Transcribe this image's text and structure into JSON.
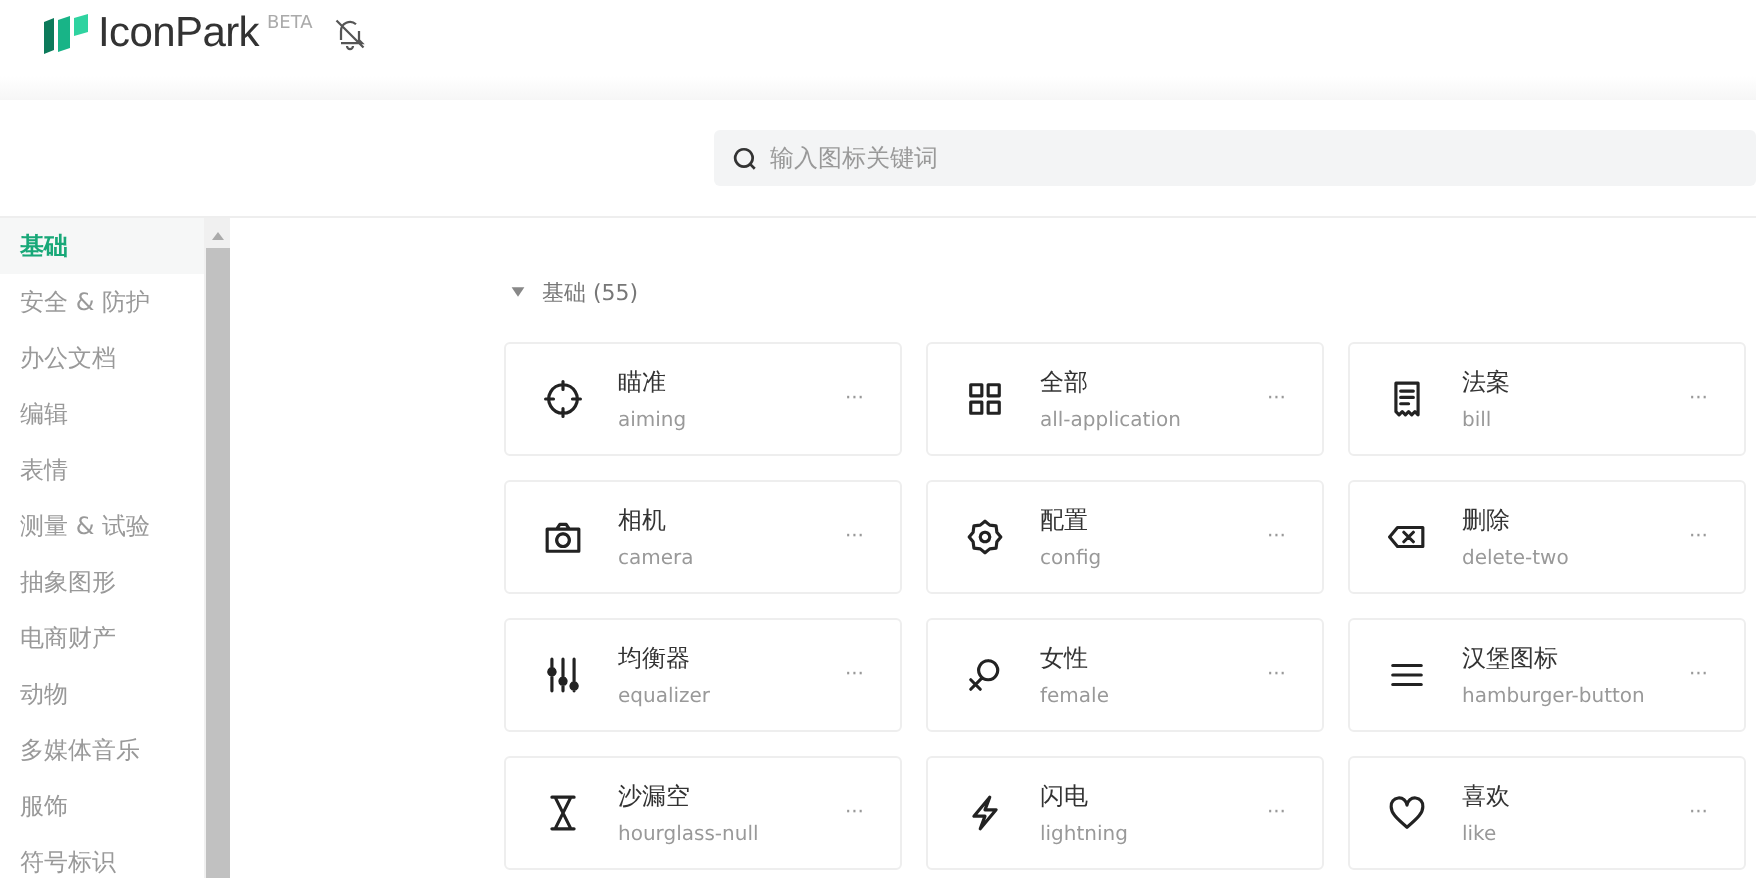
{
  "header": {
    "logo": "IconPark",
    "badge": "BETA"
  },
  "search": {
    "placeholder": "输入图标关键词"
  },
  "sidebar": {
    "items": [
      {
        "label": "基础",
        "selected": true
      },
      {
        "label": "安全 & 防护",
        "selected": false
      },
      {
        "label": "办公文档",
        "selected": false
      },
      {
        "label": "编辑",
        "selected": false
      },
      {
        "label": "表情",
        "selected": false
      },
      {
        "label": "测量 & 试验",
        "selected": false
      },
      {
        "label": "抽象图形",
        "selected": false
      },
      {
        "label": "电商财产",
        "selected": false
      },
      {
        "label": "动物",
        "selected": false
      },
      {
        "label": "多媒体音乐",
        "selected": false
      },
      {
        "label": "服饰",
        "selected": false
      },
      {
        "label": "符号标识",
        "selected": false
      }
    ]
  },
  "section": {
    "title": "基础 (55)",
    "expanded": true,
    "icons": [
      {
        "title": "瞄准",
        "name": "aiming"
      },
      {
        "title": "全部",
        "name": "all-application"
      },
      {
        "title": "法案",
        "name": "bill"
      },
      {
        "title": "相机",
        "name": "camera"
      },
      {
        "title": "配置",
        "name": "config"
      },
      {
        "title": "删除",
        "name": "delete-two"
      },
      {
        "title": "均衡器",
        "name": "equalizer"
      },
      {
        "title": "女性",
        "name": "female"
      },
      {
        "title": "汉堡图标",
        "name": "hamburger-button"
      },
      {
        "title": "沙漏空",
        "name": "hourglass-null"
      },
      {
        "title": "闪电",
        "name": "lightning"
      },
      {
        "title": "喜欢",
        "name": "like"
      }
    ],
    "more": "···"
  }
}
